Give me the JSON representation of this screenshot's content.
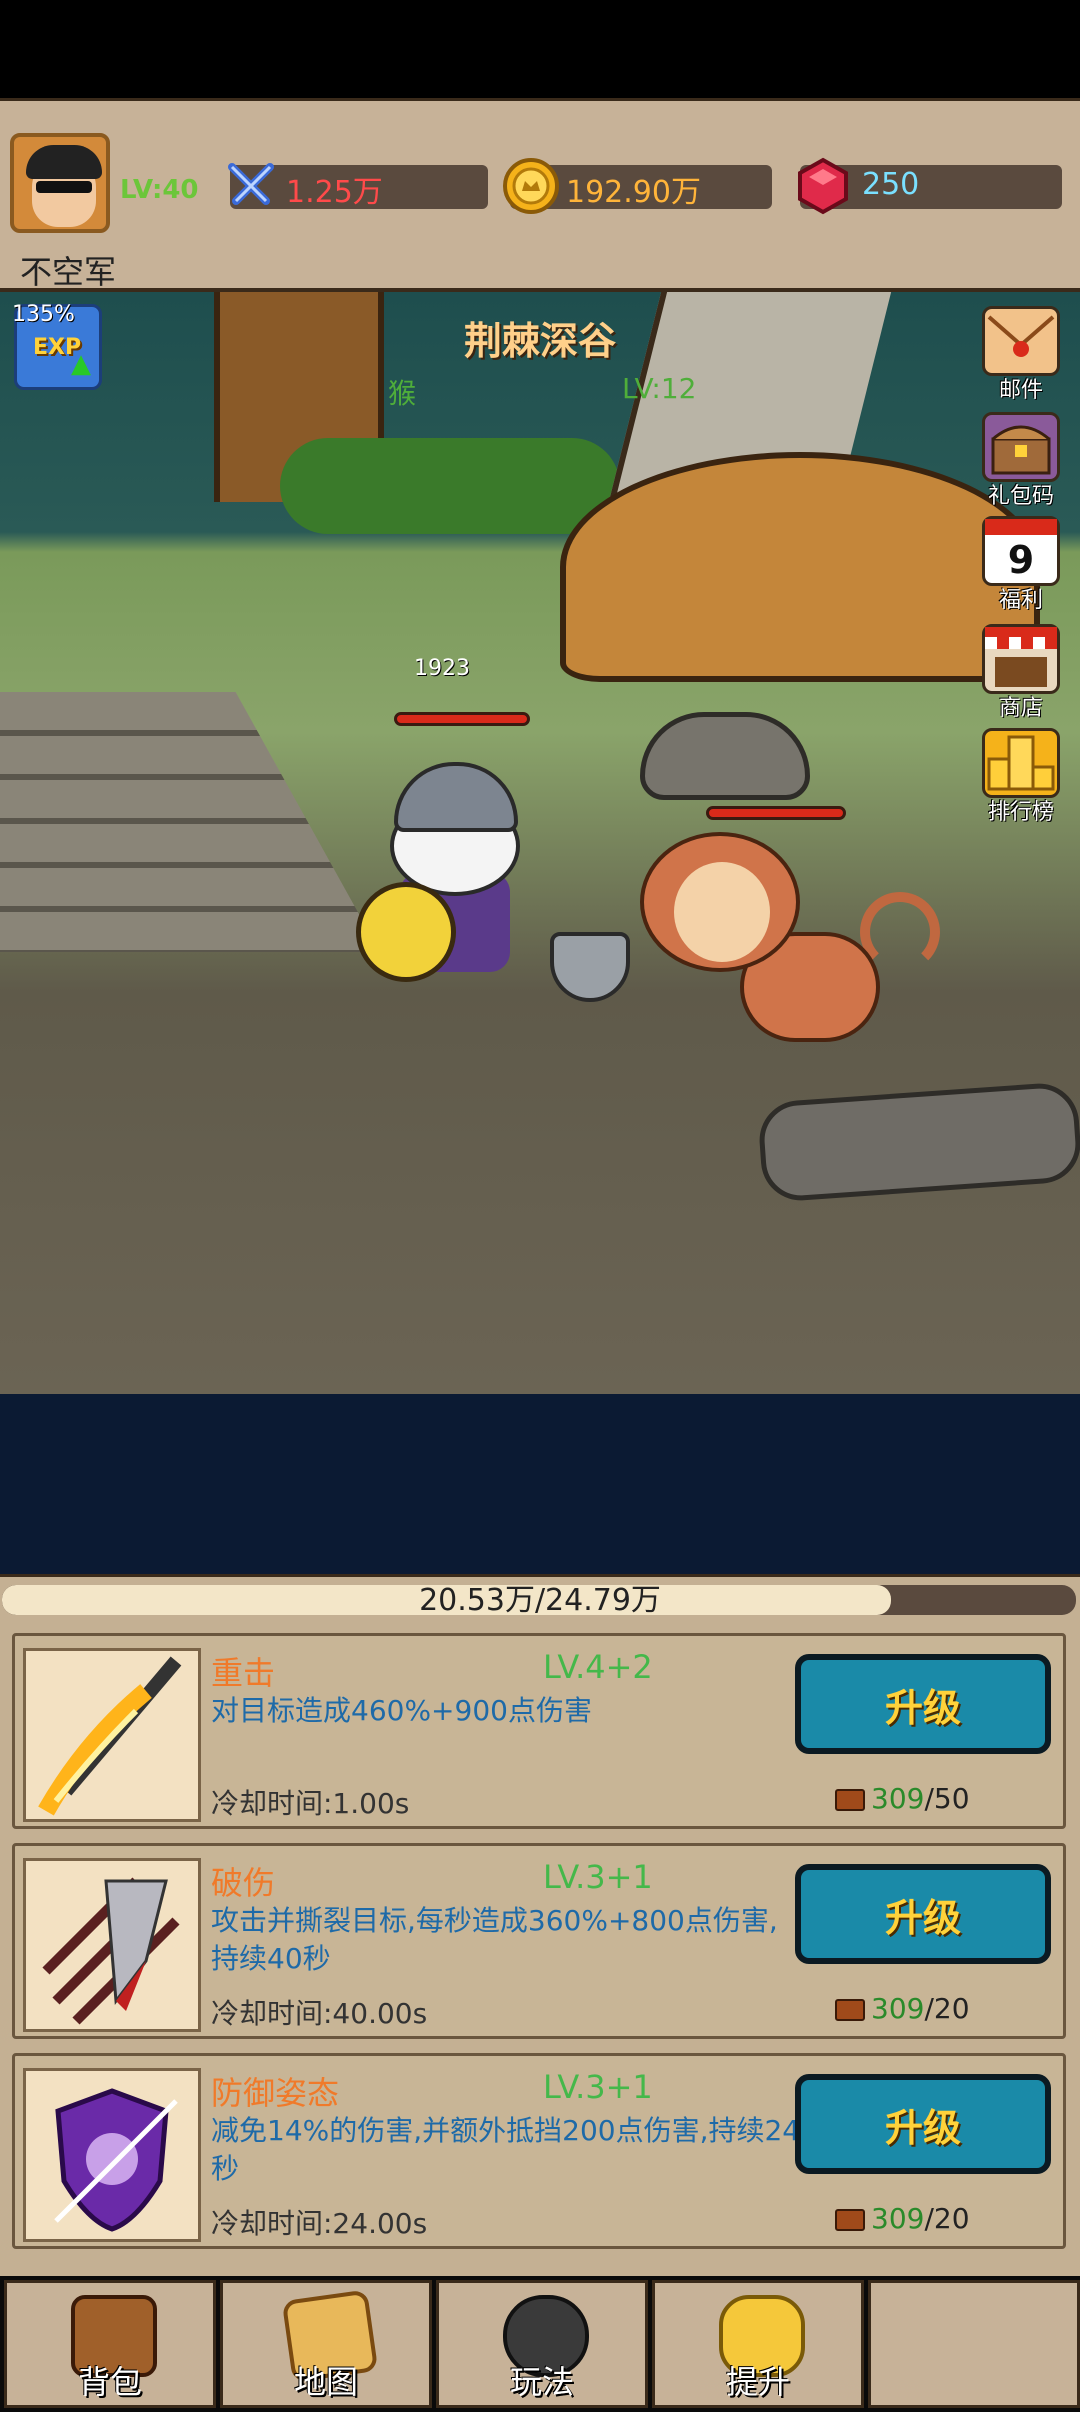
{
  "player": {
    "level": "LV:40",
    "name": "不空军"
  },
  "resources": {
    "power": "1.25万",
    "gold": "192.90万",
    "gems": "250"
  },
  "scene": {
    "title": "荆棘深谷",
    "enemy_name": "猴",
    "enemy_level": "LV:12",
    "exp_percent": "135%",
    "exp_label": "EXP",
    "hero_hp": "1923",
    "hero_hp_fraction": 1.0,
    "enemy_hp_fraction": 1.0
  },
  "side_buttons": [
    {
      "label": "邮件",
      "icon": "mail-icon"
    },
    {
      "label": "礼包码",
      "icon": "treasure-chest-icon"
    },
    {
      "label": "福利",
      "icon": "calendar-icon"
    },
    {
      "label": "商店",
      "icon": "shop-icon"
    },
    {
      "label": "排行榜",
      "icon": "trophy-icon"
    }
  ],
  "progress": {
    "text": "20.53万/24.79万",
    "fraction": 0.828
  },
  "skills": [
    {
      "name": "重击",
      "level": "LV.4+2",
      "desc": "对目标造成460%+900点伤害",
      "cooldown": "冷却时间:1.00s",
      "button": "升级",
      "cost_have": "309",
      "cost_need": "/50"
    },
    {
      "name": "破伤",
      "level": "LV.3+1",
      "desc": "攻击并撕裂目标,每秒造成360%+800点伤害,持续40秒",
      "cooldown": "冷却时间:40.00s",
      "button": "升级",
      "cost_have": "309",
      "cost_need": "/20"
    },
    {
      "name": "防御姿态",
      "level": "LV.3+1",
      "desc": "减免14%的伤害,并额外抵挡200点伤害,持续24秒",
      "cooldown": "冷却时间:24.00s",
      "button": "升级",
      "cost_have": "309",
      "cost_need": "/20"
    }
  ],
  "nav": [
    {
      "label": "背包",
      "icon": "backpack-icon"
    },
    {
      "label": "地图",
      "icon": "map-icon"
    },
    {
      "label": "玩法",
      "icon": "gamepad-icon"
    },
    {
      "label": "提升",
      "icon": "fist-icon"
    },
    {
      "label": "",
      "icon": ""
    }
  ],
  "colors": {
    "panel": "#c4b093",
    "accent_green": "#44b84a",
    "skill_name": "#f07a2a",
    "button": "#1a8aa8",
    "button_text": "#ffd23a"
  }
}
